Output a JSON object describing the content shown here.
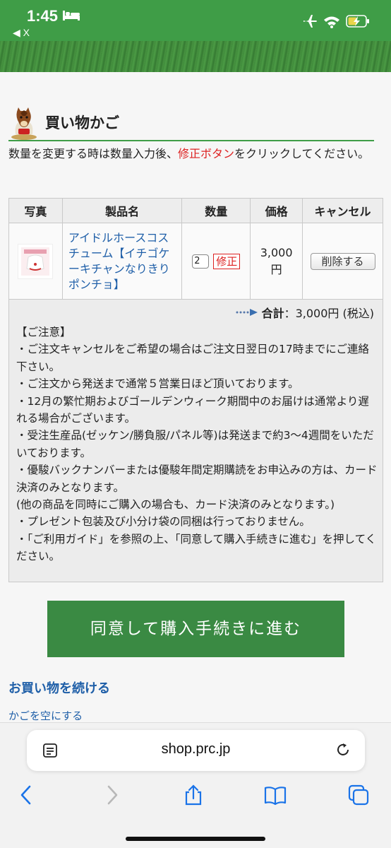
{
  "status": {
    "time": "1:45",
    "back_app": "◀ X"
  },
  "page": {
    "heading": "買い物かご",
    "instruction_a": "数量を変更する時は数量入力後、",
    "instruction_red": "修正ボタン",
    "instruction_b": "をクリックしてください。"
  },
  "table": {
    "headers": [
      "写真",
      "製品名",
      "数量",
      "価格",
      "キャンセル"
    ],
    "item": {
      "name": "アイドルホースコスチューム【イチゴケーキチャンなりきりポンチョ】",
      "quantity": "2",
      "fix_label": "修正",
      "price": "3,000円",
      "delete_label": "削除する"
    }
  },
  "total": {
    "label": "合計",
    "value": "：3,000円 (税込)"
  },
  "notes": [
    "【ご注意】",
    "・ご注文キャンセルをご希望の場合はご注文日翌日の17時までにご連絡下さい。",
    "・ご注文から発送まで通常５営業日ほど頂いております。",
    "・12月の繁忙期およびゴールデンウィーク期間中のお届けは通常より遅れる場合がございます。",
    "・受注生産品(ゼッケン/勝負服/パネル等)は発送まで約3～4週間をいただいております。",
    "・優駿バックナンバーまたは優駿年間定期購読をお申込みの方は、カード決済のみとなります。",
    "(他の商品を同時にご購入の場合も、カード決済のみとなります。)",
    "・プレゼント包装及び小分け袋の同梱は行っておりません。",
    "・「ご利用ガイド」を参照の上、「同意して購入手続きに進む」を押してください。"
  ],
  "actions": {
    "agree": "同意して購入手続きに進む",
    "continue": "お買い物を続ける",
    "empty": "かごを空にする"
  },
  "browser": {
    "url": "shop.prc.jp"
  },
  "colors": {
    "brand_green": "#3f9d47",
    "button_green": "#3a8a43",
    "link_blue": "#1f5fa8",
    "alert_red": "#d22"
  }
}
